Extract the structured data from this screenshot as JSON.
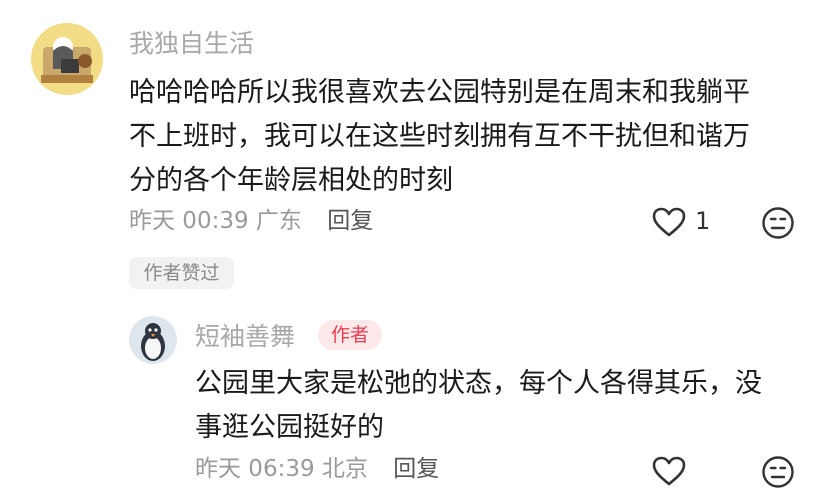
{
  "comment": {
    "username": "我独自生活",
    "lines": [
      "哈哈哈哈所以我很喜欢去公园特别是在周末和我躺平",
      "不上班时，我可以在这些时刻拥有互不干扰但和谐万",
      "分的各个年龄层相处的时刻"
    ],
    "time": "昨天 00:39",
    "location": "广东",
    "reply_label": "回复",
    "like_count": "1",
    "author_liked_badge": "作者赞过"
  },
  "reply": {
    "username": "短袖善舞",
    "author_badge": "作者",
    "lines": [
      "公园里大家是松弛的状态，每个人各得其乐，没",
      "事逛公园挺好的"
    ],
    "time": "昨天 06:39",
    "location": "北京",
    "reply_label": "回复"
  },
  "colors": {
    "username": "#a8a8a8",
    "text": "#1a1a1a",
    "meta": "#9a9a9a",
    "author_badge_text": "#ee3d50",
    "author_badge_bg": "#fde8ea"
  }
}
